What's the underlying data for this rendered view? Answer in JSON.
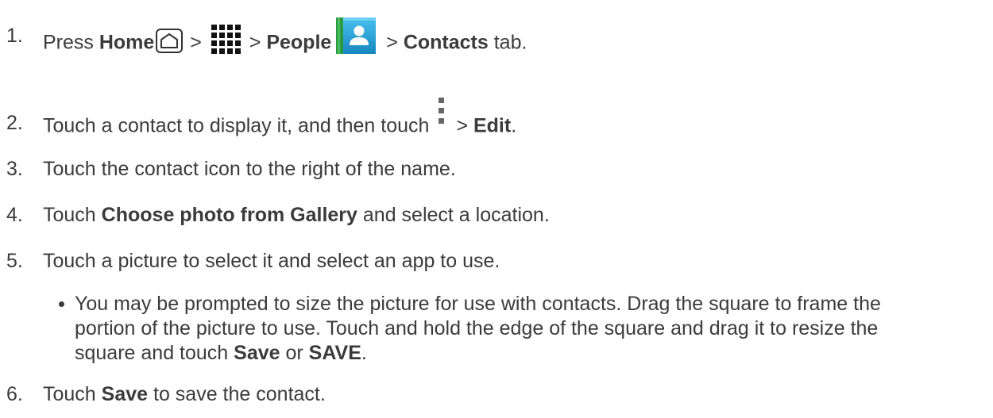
{
  "steps": [
    {
      "num": "1.",
      "parts": {
        "a": "Press ",
        "home": "Home",
        "sep1": " > ",
        "sep2": " > ",
        "people": "People",
        "sep3": " > ",
        "contacts": "Contacts",
        "tail": " tab."
      },
      "icons": [
        "home-key-icon",
        "apps-grid-icon",
        "people-app-icon"
      ]
    },
    {
      "num": "2.",
      "parts": {
        "a": "Touch a contact to display it, and then touch",
        "sep": "> ",
        "edit": "Edit",
        "tail": "."
      },
      "icons": [
        "menu-dots-icon"
      ]
    },
    {
      "num": "3.",
      "text": "Touch the contact icon to the right of the name."
    },
    {
      "num": "4.",
      "parts": {
        "a": "Touch ",
        "bold": "Choose photo from Gallery",
        "tail": " and select a location."
      }
    },
    {
      "num": "5.",
      "text": "Touch a picture to select it and select an app to use."
    },
    {
      "num": "6.",
      "parts": {
        "a": "Touch ",
        "bold": "Save",
        "tail": " to save the contact."
      }
    }
  ],
  "bullet": {
    "line1": "You may be prompted to size the picture for use with contacts. Drag the square to frame the",
    "line2": "portion of the picture to use. Touch and hold the edge of the square and drag it to resize the",
    "line3a": "square and touch ",
    "save": "Save",
    "or": " or ",
    "save_caps": "SAVE",
    "tail": "."
  },
  "colors": {
    "text": "#3b3b3b",
    "people_icon_top": "#3fb8e6",
    "people_icon_bottom": "#1a8ec4",
    "people_icon_spine": "#2b9a44"
  }
}
